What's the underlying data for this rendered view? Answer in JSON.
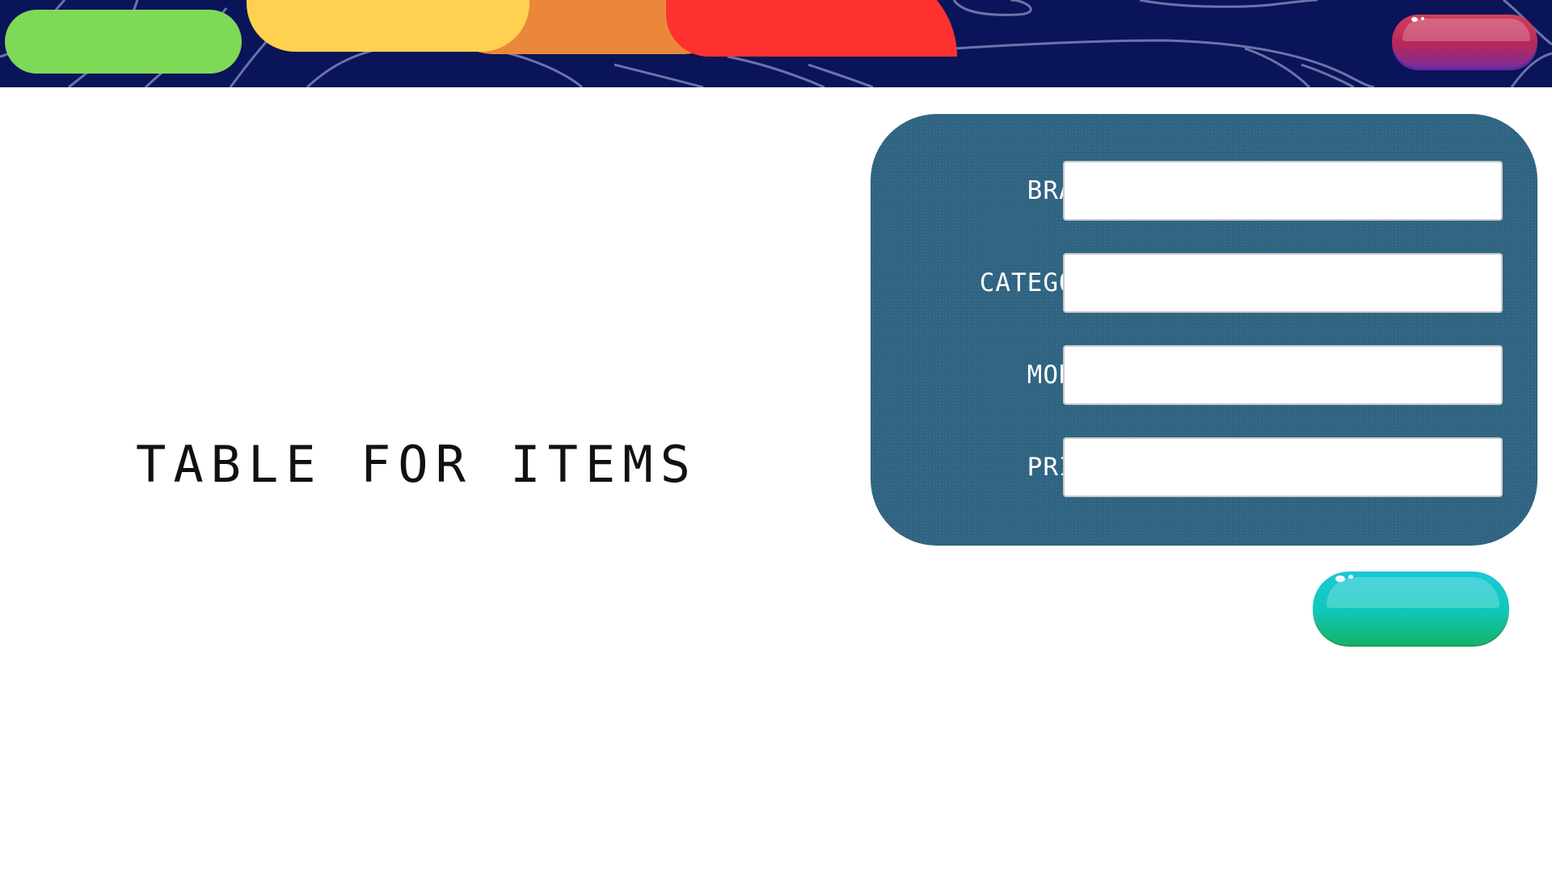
{
  "header": {
    "tabs": [
      {
        "label": "",
        "color": "#7ed957"
      },
      {
        "label": "",
        "color": "#ffd150"
      },
      {
        "label": "",
        "color": "#eb873a"
      },
      {
        "label": "",
        "color": "#ff3131"
      }
    ],
    "background_color": "#0a1459",
    "top_right_button_label": ""
  },
  "main": {
    "title": "TABLE FOR ITEMS"
  },
  "form": {
    "panel_color": "#2f6482",
    "fields": {
      "brand": {
        "label": "BRAND",
        "value": "",
        "placeholder": ""
      },
      "category": {
        "label": "CATEGORY",
        "value": "",
        "placeholder": ""
      },
      "model": {
        "label": "MODEL",
        "value": "",
        "placeholder": ""
      },
      "price": {
        "label": "PRICE",
        "value": "",
        "placeholder": ""
      }
    },
    "submit_label": ""
  },
  "colors": {
    "accent_teal": "#10c8b8",
    "accent_magenta": "#b8285a"
  }
}
